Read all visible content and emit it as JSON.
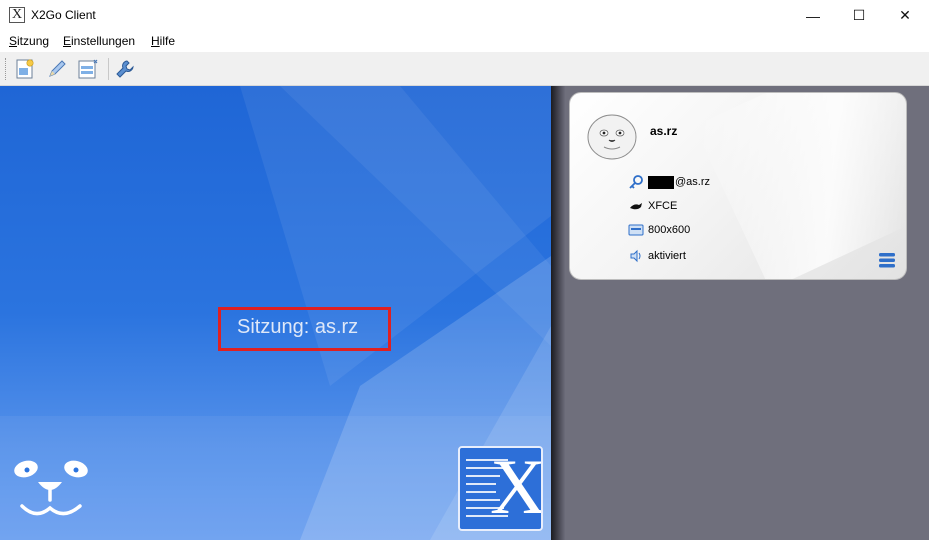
{
  "window": {
    "title": "X2Go Client",
    "app_icon_glyph": "X",
    "controls": {
      "minimize": "—",
      "maximize": "☐",
      "close": "✕"
    }
  },
  "menu": [
    {
      "accel": "S",
      "rest": "itzung"
    },
    {
      "accel": "E",
      "rest": "instellungen"
    },
    {
      "accel": "H",
      "rest": "ilfe"
    }
  ],
  "toolbar": {
    "icons": [
      "new-session-icon",
      "edit-session-icon",
      "session-list-icon",
      "settings-wrench-icon"
    ]
  },
  "main": {
    "session_label": "Sitzung:  as.rz",
    "logo_letter": "X",
    "highlight_color": "#e02020"
  },
  "session_card": {
    "name": "as.rz",
    "login_suffix": "@as.rz",
    "desktop": "XFCE",
    "resolution": "800x600",
    "sound": "aktiviert"
  },
  "colors": {
    "accent_blue": "#2b74df",
    "right_pane_bg": "#6f6f7c"
  }
}
